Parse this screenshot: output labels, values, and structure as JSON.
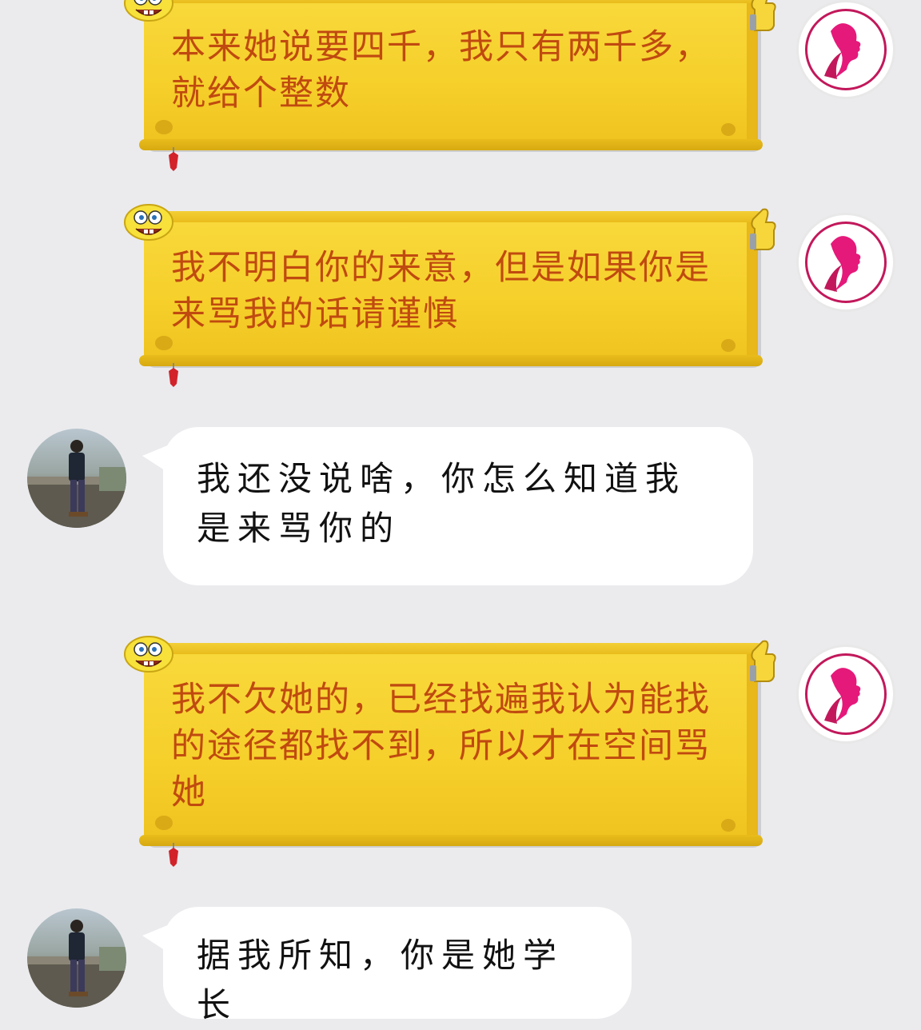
{
  "messages": [
    {
      "sender": "her",
      "style": "scroll",
      "text": "本来她说要四千，我只有两千多，就给个整数"
    },
    {
      "sender": "her",
      "style": "scroll",
      "text": "我不明白你的来意，但是如果你是来骂我的话请谨慎"
    },
    {
      "sender": "him",
      "style": "white",
      "text": "我还没说啥，你怎么知道我是来骂你的"
    },
    {
      "sender": "her",
      "style": "scroll",
      "text": "我不欠她的，已经找遍我认为能找的途径都找不到，所以才在空间骂她"
    },
    {
      "sender": "him",
      "style": "white",
      "text": "据我所知，你是她学长"
    }
  ],
  "colors": {
    "background": "#ebebee",
    "scroll_yellow": "#f6cf2a",
    "scroll_text": "#c04a10",
    "her_avatar_accent": "#e5197a",
    "white_bubble": "#ffffff"
  },
  "icons": {
    "her_avatar": "woman-profile-logo-icon",
    "scroll_corner_left": "spongebob-icon",
    "scroll_corner_right": "thumbs-up-icon",
    "scroll_bottom": "red-tassel-icon"
  }
}
